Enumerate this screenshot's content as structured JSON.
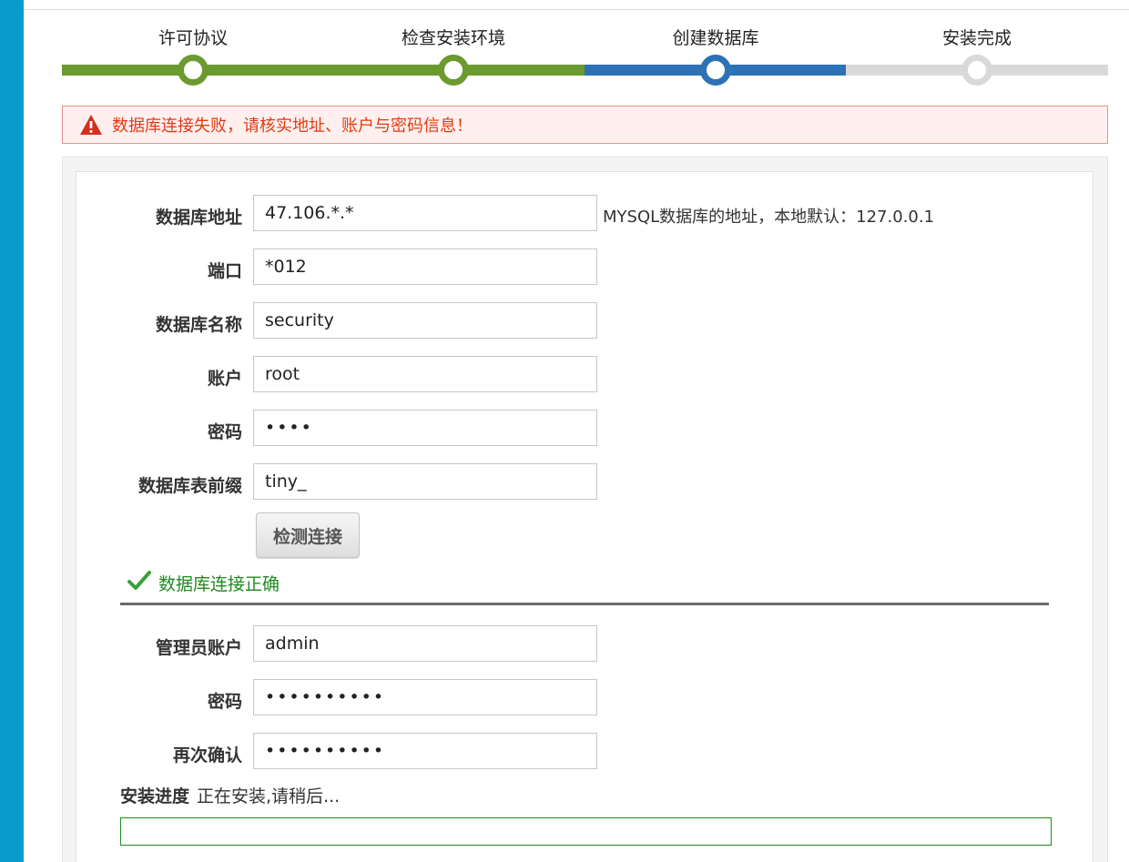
{
  "colors": {
    "done": "#6b9a2f",
    "current": "#2c72b4",
    "pending": "#d9d9d9",
    "error": "#e23a12",
    "success": "#1f8a1f"
  },
  "steps": [
    {
      "label": "许可协议",
      "state": "done"
    },
    {
      "label": "检查安装环境",
      "state": "done"
    },
    {
      "label": "创建数据库",
      "state": "current"
    },
    {
      "label": "安装完成",
      "state": "pending"
    }
  ],
  "alert": {
    "icon": "warning-icon",
    "text": "数据库连接失败，请核实地址、账户与密码信息！"
  },
  "db": {
    "host": {
      "label": "数据库地址",
      "value": "47.106.*.*",
      "hint": "MYSQL数据库的地址，本地默认：127.0.0.1"
    },
    "port": {
      "label": "端口",
      "value": "*012"
    },
    "name": {
      "label": "数据库名称",
      "value": "security"
    },
    "user": {
      "label": "账户",
      "value": "root"
    },
    "password": {
      "label": "密码",
      "value": "••••"
    },
    "prefix": {
      "label": "数据库表前缀",
      "value": "tiny_"
    },
    "check_button": "检测连接",
    "status": {
      "icon": "check-icon",
      "text": "数据库连接正确"
    }
  },
  "admin": {
    "user": {
      "label": "管理员账户",
      "value": "admin"
    },
    "password": {
      "label": "密码",
      "value": "••••••••••"
    },
    "confirm": {
      "label": "再次确认",
      "value": "••••••••••"
    }
  },
  "progress": {
    "label": "安装进度",
    "status": "正在安装,请稍后...",
    "percent": 0
  }
}
